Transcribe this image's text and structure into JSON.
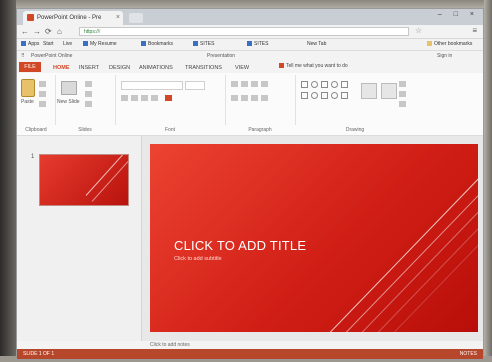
{
  "browser": {
    "tab_title": "PowerPoint Online - Pre",
    "tab_close": "×",
    "window_controls": "– □ ×",
    "back": "←",
    "forward": "→",
    "reload": "⟳",
    "home": "⌂",
    "url_secure": "https://",
    "url_rest": "/",
    "star": "☆",
    "menu": "≡",
    "bookmarks": [
      "Apps",
      "Start",
      "Live",
      "My Resume",
      "Bookmarks",
      "SITES",
      "SITES",
      "New Tab",
      "Other bookmarks"
    ]
  },
  "office": {
    "top_left": "PowerPoint Online",
    "top_center": "Presentation",
    "top_right": "Sign in",
    "ribbon_tabs": [
      "FILE",
      "HOME",
      "INSERT",
      "DESIGN",
      "ANIMATIONS",
      "TRANSITIONS",
      "VIEW"
    ],
    "tell_me": "Tell me what you want to do",
    "groups": [
      "Clipboard",
      "Slides",
      "Font",
      "Paragraph",
      "Drawing"
    ],
    "paste_label": "Paste",
    "new_slide_label": "New Slide"
  },
  "thumbnails": {
    "slide_number": "1"
  },
  "slide": {
    "title_placeholder": "CLICK TO ADD TITLE",
    "subtitle_placeholder": "Click to add subtitle"
  },
  "notes": {
    "placeholder": "Click to add notes"
  },
  "status": {
    "left": "SLIDE 1 OF 1",
    "right": "NOTES"
  },
  "colors": {
    "accent": "#d24726",
    "slide_red": "#d11f16"
  }
}
